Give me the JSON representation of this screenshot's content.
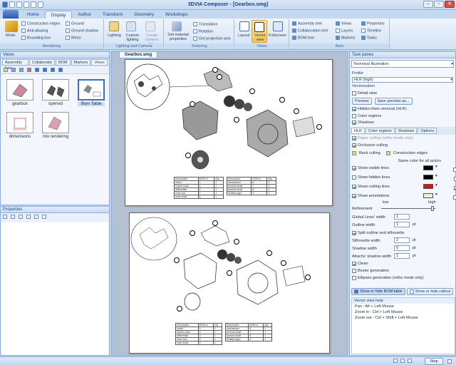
{
  "app": {
    "title": "3DVIA Composer - [Gearbox.smg]",
    "win_buttons": [
      "–",
      "▫",
      "✕"
    ]
  },
  "ribbon_tabs": [
    "Home",
    "Display",
    "Author",
    "Transform",
    "Geometry",
    "Workshops"
  ],
  "ribbon": {
    "rendering": {
      "label": "Rendering",
      "mode": "Mode",
      "items": [
        "Construction edges",
        "Anti-aliasing",
        "Bounding box"
      ],
      "items2": [
        "Ground",
        "Ground shadow",
        "Mirror"
      ]
    },
    "lighting": {
      "label": "Lighting and Camera",
      "buttons": [
        "Lighting",
        "Custom lighting",
        "Create camera key"
      ]
    },
    "texturing": {
      "label": "Texturing",
      "get_material": "Get material properties",
      "items": [
        "Translation",
        "Rotation",
        "Get projection axis"
      ]
    },
    "views": {
      "label": "Views",
      "buttons": [
        "Layout",
        "Vector view",
        "Fullscreen"
      ]
    },
    "bars": {
      "label": "Bars",
      "col1": [
        "Assembly tree",
        "Collaboration tree",
        "BOM tree"
      ],
      "col2": [
        "Views",
        "Layers",
        "Markers"
      ],
      "col3": [
        "Properties",
        "Timeline",
        "Tasks"
      ]
    }
  },
  "views_panel": {
    "title": "Views",
    "tabs": [
      "Assembly tree",
      "Collaborate",
      "BOM",
      "Markers",
      "Views"
    ],
    "items": [
      "gearbox",
      "opened",
      "Bom Table",
      "dimensions",
      "mix rendering"
    ]
  },
  "properties_panel": {
    "title": "Properties"
  },
  "doc": {
    "tab": "Gearbox.smg",
    "bom1": {
      "headers": [
        "Description",
        "BOM Id",
        "Qty"
      ],
      "rows": [
        [
          "clutch",
          "1",
          "1"
        ],
        [
          "Clutch Case",
          "2",
          "1"
        ],
        [
          "differential",
          "3",
          "1"
        ],
        [
          "Gear box",
          "4",
          "1"
        ],
        [
          "main shaft",
          "5",
          "1"
        ]
      ]
    },
    "bom2": {
      "headers": [
        "Description",
        "BOM Id",
        "Qty"
      ],
      "rows": [
        [
          "mechanism",
          "6",
          "1"
        ],
        [
          "reverse shaft",
          "7",
          "1"
        ],
        [
          "second shaft",
          "8",
          "1"
        ],
        [
          "Shaft(rough)",
          "9",
          "1"
        ]
      ]
    },
    "callouts": [
      "1",
      "2",
      "3",
      "4",
      "5",
      "6",
      "7",
      "8",
      "9"
    ]
  },
  "task_pane": {
    "title": "Task panes",
    "dropdown": "Technical Illustration",
    "profile_label": "Profile",
    "profile": "HLR (high)",
    "vectorization_label": "Vectorization",
    "detail_view": "Detail view",
    "preview": "Preview",
    "save_preview": "Save preview as...",
    "checks": [
      "Hidden lines removal (HLR)",
      "Color regions",
      "Shadows"
    ],
    "tabs": [
      "HLR",
      "Color regions",
      "Shadows",
      "Options"
    ],
    "paper_culling": "Paper culling (ortho mode only)",
    "occlusion": "Occlusion culling",
    "back_culling": "Back culling",
    "construction_edges": "Construction edges",
    "same_color": "Same color for all actors",
    "lines": [
      "Show visible lines",
      "Show hidden lines",
      "Show cutting lines",
      "Show annotations"
    ],
    "line_colors": [
      "#000000",
      "#000000",
      "#e01010",
      "#f0ead8"
    ],
    "low": "low",
    "high": "high",
    "refinement": "Refinement",
    "global_lines_width": "Global Lines' width",
    "global_lines_value": "1",
    "outline_width": "Outline width",
    "outline_value": "1",
    "pt": "pt",
    "split_outline": "Split outline and silhouette",
    "silhouette_width": "Silhouette width",
    "silhouette_value": "2",
    "shadow_width": "Shadow width",
    "shadow_value": "0",
    "attachs_width": "Attachs' shadow width",
    "attachs_value": "1",
    "clean": "Clean",
    "bezier": "Bezier generation",
    "ellipses": "Ellipses generation (ortho mode only)",
    "show_bom": "Show or hide BOM table",
    "show_callout": "Show or hide callout",
    "help_title": "Vector view help",
    "help": [
      "Pan : Alt + Left Mouse",
      "Zoom in : Ctrl + Left Mouse",
      "Zoom out : Ctrl + Shift + Left Mouse"
    ]
  },
  "status": {
    "stop": "Stop"
  }
}
